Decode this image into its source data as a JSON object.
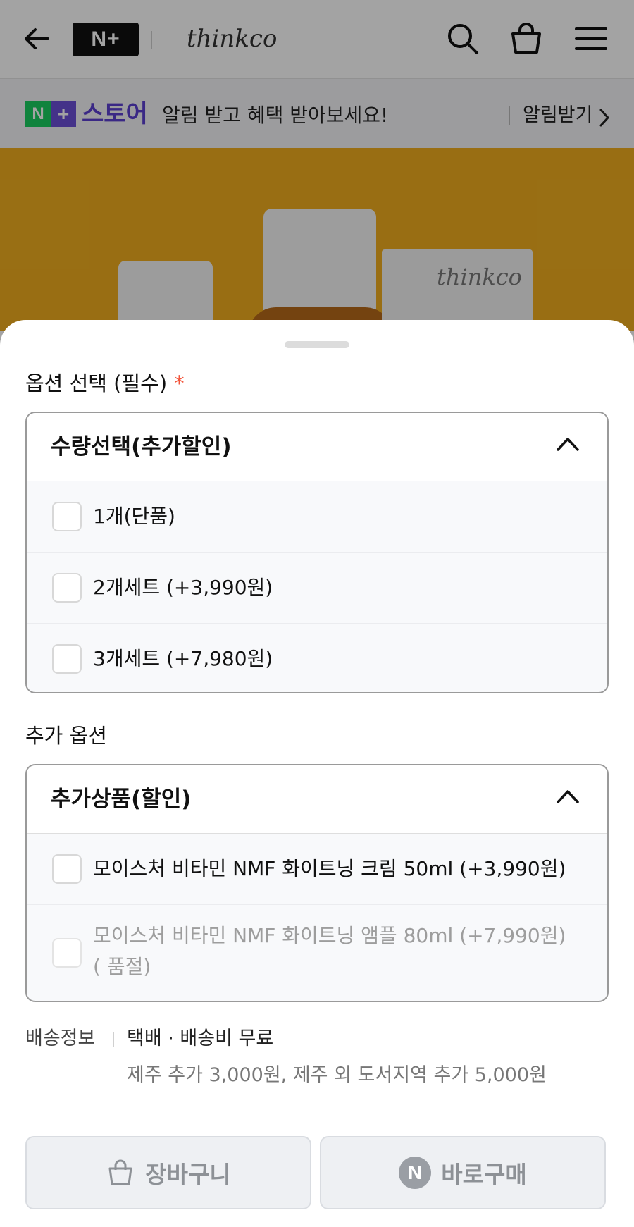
{
  "header": {
    "logo_text": "N+",
    "brand_name": "thinkco"
  },
  "notice": {
    "store_badge": "N+",
    "store_label": "스토어",
    "message": "알림 받고 혜택 받아보세요!",
    "action_label": "알림받기"
  },
  "hero": {
    "box_brand": "thinkco"
  },
  "sheet": {
    "required_section": {
      "title": "옵션 선택 (필수)",
      "required_mark": "*",
      "group_title": "수량선택(추가할인)",
      "options": [
        {
          "label": "1개(단품)",
          "checked": false
        },
        {
          "label": "2개세트 (+3,990원)",
          "checked": false
        },
        {
          "label": "3개세트 (+7,980원)",
          "checked": false
        }
      ]
    },
    "additional_section": {
      "title": "추가 옵션",
      "group_title": "추가상품(할인)",
      "options": [
        {
          "label": "모이스처 비타민 NMF 화이트닝 크림 50ml (+3,990원)",
          "checked": false,
          "disabled": false
        },
        {
          "label": "모이스처 비타민 NMF 화이트닝 앰플 80ml (+7,990원) ( 품절)",
          "checked": false,
          "disabled": true
        }
      ]
    },
    "shipping": {
      "label": "배송정보",
      "value": "택배 · 배송비 무료",
      "extra": "제주 추가 3,000원, 제주 외 도서지역 추가 5,000원"
    },
    "buttons": {
      "cart_label": "장바구니",
      "buy_badge": "N",
      "buy_label": "바로구매"
    }
  },
  "colors": {
    "hero_background": "#f0ad1f",
    "store_green": "#19ce60",
    "store_purple": "#5b3fd0",
    "required_star": "#f2553b",
    "disabled_button_text": "#8d9196"
  },
  "icons": [
    "back-arrow-icon",
    "search-icon",
    "shopping-bag-icon",
    "hamburger-menu-icon",
    "chevron-right-icon",
    "chevron-up-icon",
    "cart-icon"
  ]
}
